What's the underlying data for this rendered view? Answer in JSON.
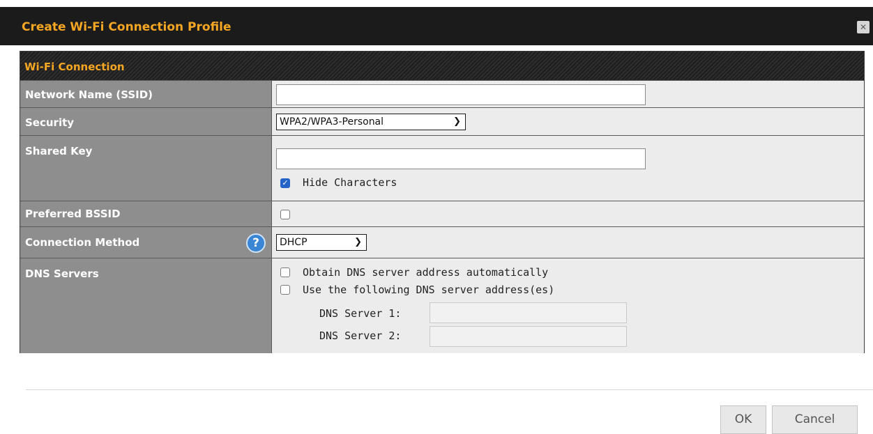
{
  "dialog": {
    "title": "Create Wi-Fi Connection Profile",
    "close_icon": "close-icon",
    "accent_color": "#f5a623"
  },
  "section": {
    "header": "Wi-Fi Connection"
  },
  "fields": {
    "ssid": {
      "label": "Network Name (SSID)",
      "value": ""
    },
    "security": {
      "label": "Security",
      "selected": "WPA2/WPA3-Personal"
    },
    "shared_key": {
      "label": "Shared Key",
      "value": "",
      "hide_characters_label": "Hide Characters",
      "hide_characters_checked": true
    },
    "preferred_bssid": {
      "label": "Preferred BSSID",
      "checked": false
    },
    "connection_method": {
      "label": "Connection Method",
      "selected": "DHCP",
      "help_icon": "help-icon"
    },
    "dns_servers": {
      "label": "DNS Servers",
      "option_auto": "Obtain DNS server address automatically",
      "option_manual": "Use the following DNS server address(es)",
      "server1_label": "DNS Server 1:",
      "server2_label": "DNS Server 2:",
      "server1_value": "",
      "server2_value": ""
    }
  },
  "footer": {
    "ok_label": "OK",
    "cancel_label": "Cancel"
  }
}
